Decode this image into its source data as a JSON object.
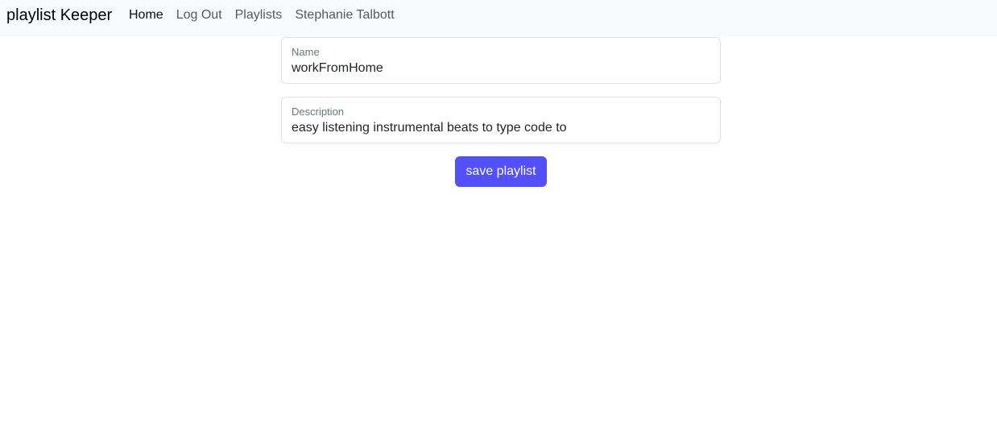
{
  "navbar": {
    "brand": "playlist Keeper",
    "links": [
      {
        "label": "Home",
        "active": true
      },
      {
        "label": "Log Out",
        "active": false
      },
      {
        "label": "Playlists",
        "active": false
      },
      {
        "label": "Stephanie Talbott",
        "active": false
      }
    ]
  },
  "form": {
    "name": {
      "label": "Name",
      "value": "workFromHome"
    },
    "description": {
      "label": "Description",
      "value": "easy listening instrumental beats to type code to"
    },
    "save_label": "save playlist"
  },
  "colors": {
    "navbar_bg": "#f8f9fa",
    "accent": "#524ffb"
  }
}
